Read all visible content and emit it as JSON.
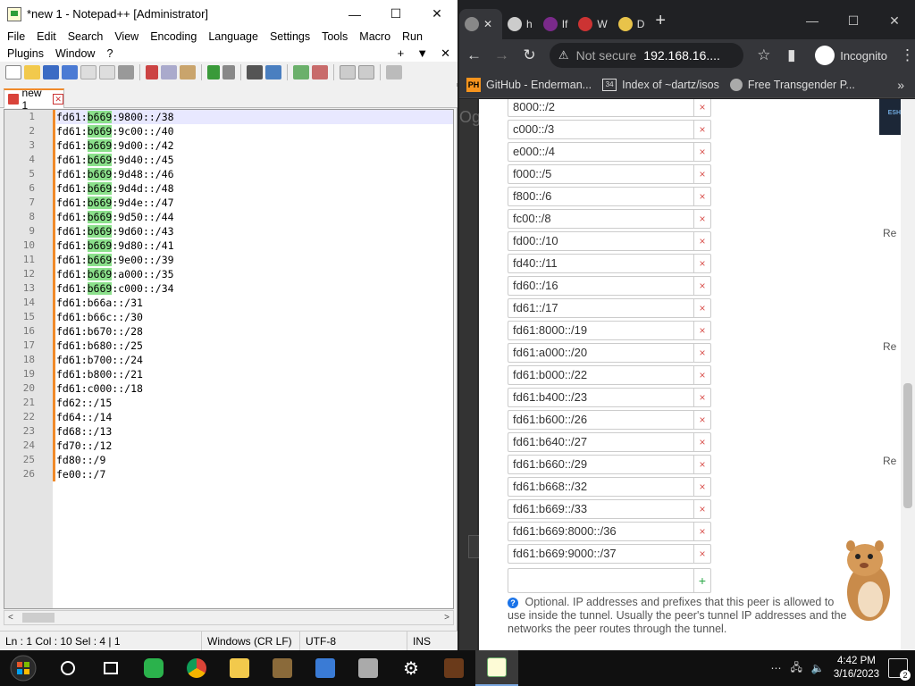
{
  "npp": {
    "title": "*new 1 - Notepad++ [Administrator]",
    "menu_row1": [
      "File",
      "Edit",
      "Search",
      "View",
      "Encoding",
      "Language",
      "Settings",
      "Tools",
      "Macro",
      "Run"
    ],
    "menu_row2": [
      "Plugins",
      "Window",
      "?"
    ],
    "menu_ctrls": [
      "+",
      "▼",
      "✕"
    ],
    "tab_label": "new 1",
    "lines": [
      {
        "n": "1",
        "pre": "fd61:",
        "hl": "b669",
        "post": ":9800::/38"
      },
      {
        "n": "2",
        "pre": "fd61:",
        "hl": "b669",
        "post": ":9c00::/40"
      },
      {
        "n": "3",
        "pre": "fd61:",
        "hl": "b669",
        "post": ":9d00::/42"
      },
      {
        "n": "4",
        "pre": "fd61:",
        "hl": "b669",
        "post": ":9d40::/45"
      },
      {
        "n": "5",
        "pre": "fd61:",
        "hl": "b669",
        "post": ":9d48::/46"
      },
      {
        "n": "6",
        "pre": "fd61:",
        "hl": "b669",
        "post": ":9d4d::/48"
      },
      {
        "n": "7",
        "pre": "fd61:",
        "hl": "b669",
        "post": ":9d4e::/47"
      },
      {
        "n": "8",
        "pre": "fd61:",
        "hl": "b669",
        "post": ":9d50::/44"
      },
      {
        "n": "9",
        "pre": "fd61:",
        "hl": "b669",
        "post": ":9d60::/43"
      },
      {
        "n": "10",
        "pre": "fd61:",
        "hl": "b669",
        "post": ":9d80::/41"
      },
      {
        "n": "11",
        "pre": "fd61:",
        "hl": "b669",
        "post": ":9e00::/39"
      },
      {
        "n": "12",
        "pre": "fd61:",
        "hl": "b669",
        "post": ":a000::/35"
      },
      {
        "n": "13",
        "pre": "fd61:",
        "hl": "b669",
        "post": ":c000::/34"
      },
      {
        "n": "14",
        "pre": "fd61:b66a::/31",
        "hl": "",
        "post": ""
      },
      {
        "n": "15",
        "pre": "fd61:b66c::/30",
        "hl": "",
        "post": ""
      },
      {
        "n": "16",
        "pre": "fd61:b670::/28",
        "hl": "",
        "post": ""
      },
      {
        "n": "17",
        "pre": "fd61:b680::/25",
        "hl": "",
        "post": ""
      },
      {
        "n": "18",
        "pre": "fd61:b700::/24",
        "hl": "",
        "post": ""
      },
      {
        "n": "19",
        "pre": "fd61:b800::/21",
        "hl": "",
        "post": ""
      },
      {
        "n": "20",
        "pre": "fd61:c000::/18",
        "hl": "",
        "post": ""
      },
      {
        "n": "21",
        "pre": "fd62::/15",
        "hl": "",
        "post": ""
      },
      {
        "n": "22",
        "pre": "fd64::/14",
        "hl": "",
        "post": ""
      },
      {
        "n": "23",
        "pre": "fd68::/13",
        "hl": "",
        "post": ""
      },
      {
        "n": "24",
        "pre": "fd70::/12",
        "hl": "",
        "post": ""
      },
      {
        "n": "25",
        "pre": "fd80::/9",
        "hl": "",
        "post": ""
      },
      {
        "n": "26",
        "pre": "fe00::/7",
        "hl": "",
        "post": ""
      }
    ],
    "status": {
      "pos": "Ln : 1    Col : 10    Sel : 4 | 1",
      "eol": "Windows (CR LF)",
      "enc": "UTF-8",
      "mode": "INS"
    }
  },
  "chrome": {
    "tabs": [
      {
        "label": "",
        "active": true
      },
      {
        "label": "h",
        "active": false
      },
      {
        "label": "If",
        "active": false
      },
      {
        "label": "W",
        "active": false
      },
      {
        "label": "D",
        "active": false
      }
    ],
    "omnibox": {
      "security": "Not secure",
      "address": "192.168.16...."
    },
    "incognito_label": "Incognito",
    "bookmarks": [
      {
        "icon": "PH",
        "label": "GitHub - Enderman..."
      },
      {
        "icon": "34",
        "label": "Index of ~dartz/isos"
      },
      {
        "icon": "",
        "label": "Free Transgender P..."
      }
    ],
    "page": {
      "left_fragment": "Og",
      "banner_fragment": "ESHI",
      "right_labels": [
        "Re",
        "Re",
        "Re"
      ],
      "allowed_ips": [
        "8000::/2",
        "c000::/3",
        "e000::/4",
        "f000::/5",
        "f800::/6",
        "fc00::/8",
        "fd00::/10",
        "fd40::/11",
        "fd60::/16",
        "fd61::/17",
        "fd61:8000::/19",
        "fd61:a000::/20",
        "fd61:b000::/22",
        "fd61:b400::/23",
        "fd61:b600::/26",
        "fd61:b640::/27",
        "fd61:b660::/29",
        "fd61:b668::/32",
        "fd61:b669::/33",
        "fd61:b669:8000::/36",
        "fd61:b669:9000::/37"
      ],
      "new_ip_value": "",
      "delete_glyph": "×",
      "add_glyph": "+",
      "help_text": "Optional. IP addresses and prefixes that this peer is allowed to use inside the tunnel. Usually the peer's tunnel IP addresses and the networks the peer routes through the tunnel."
    }
  },
  "taskbar": {
    "time": "4:42 PM",
    "date": "3/16/2023",
    "notifications": "2"
  }
}
